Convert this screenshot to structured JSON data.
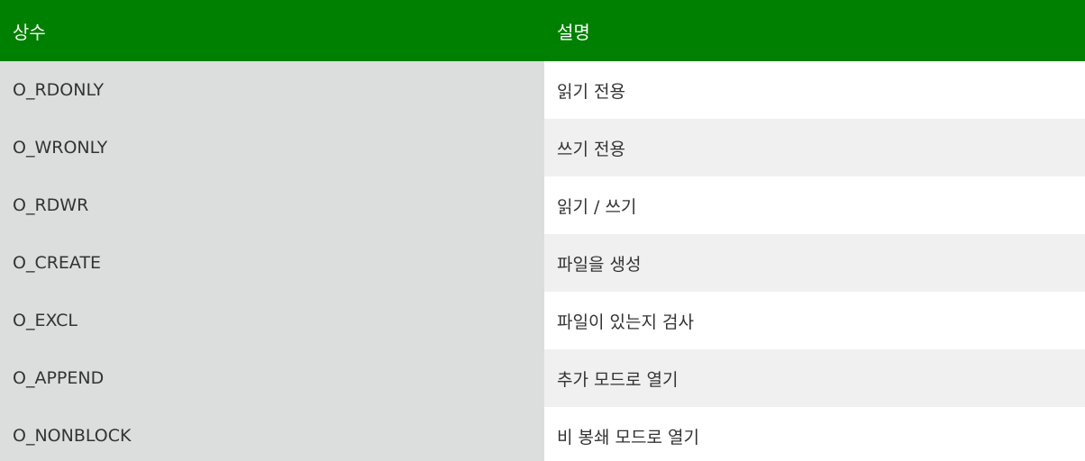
{
  "table": {
    "headers": [
      "상수",
      "설명"
    ],
    "rows": [
      {
        "constant": "O_RDONLY",
        "description": "읽기 전용"
      },
      {
        "constant": "O_WRONLY",
        "description": "쓰기 전용"
      },
      {
        "constant": "O_RDWR",
        "description": "읽기 / 쓰기"
      },
      {
        "constant": "O_CREATE",
        "description": "파일을 생성"
      },
      {
        "constant": "O_EXCL",
        "description": "파일이 있는지 검사"
      },
      {
        "constant": "O_APPEND",
        "description": "추가 모드로 열기"
      },
      {
        "constant": "O_NONBLOCK",
        "description": "비 봉쇄 모드로 열기"
      }
    ]
  },
  "colors": {
    "header_bg": "#008000",
    "header_text": "#ffffff",
    "const_col_bg": "#dcdedd",
    "row_alt_bg": "#f0f0f0"
  }
}
